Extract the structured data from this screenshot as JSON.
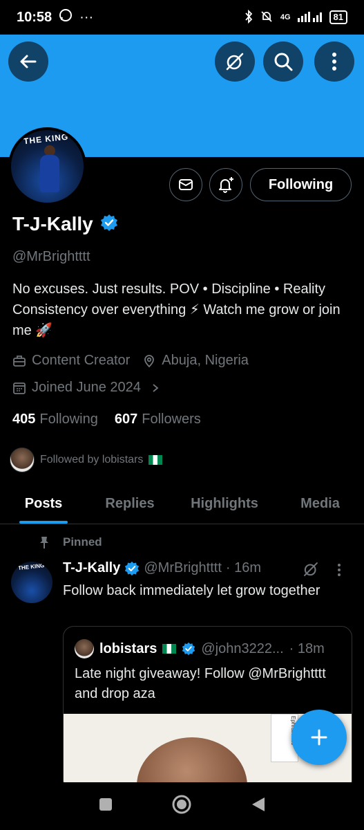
{
  "status_bar": {
    "time": "10:58",
    "network": "4G",
    "battery": "81"
  },
  "profile": {
    "display_name": "T-J-Kally",
    "handle": "@MrBrightttt",
    "bio": "No excuses. Just results.   POV • Discipline • Reality   Consistency over everything ⚡   Watch me grow or join me 🚀",
    "profession": "Content Creator",
    "location": "Abuja, Nigeria",
    "joined": "Joined June 2024",
    "following_count": "405",
    "following_label": "Following",
    "followers_count": "607",
    "followers_label": "Followers",
    "followed_by": "Followed by lobistars",
    "follow_button": "Following",
    "avatar_banner_text": "THE KING"
  },
  "tabs": [
    {
      "label": "Posts",
      "active": true
    },
    {
      "label": "Replies",
      "active": false
    },
    {
      "label": "Highlights",
      "active": false
    },
    {
      "label": "Media",
      "active": false
    }
  ],
  "post": {
    "pinned_label": "Pinned",
    "author_name": "T-J-Kally",
    "author_handle": "@MrBrightttt",
    "time": "· 16m",
    "text": "Follow back immediately let grow together",
    "quote": {
      "author_name": "lobistars",
      "author_handle": "@john3222...",
      "time": "· 18m",
      "text": "Late night giveaway! Follow @MrBrightttt and drop aza",
      "sticker_text": "Ephraimatic"
    }
  },
  "colors": {
    "accent": "#1d9bf0",
    "background": "#000000",
    "muted": "#71767b",
    "verified": "#1d9bf0"
  }
}
